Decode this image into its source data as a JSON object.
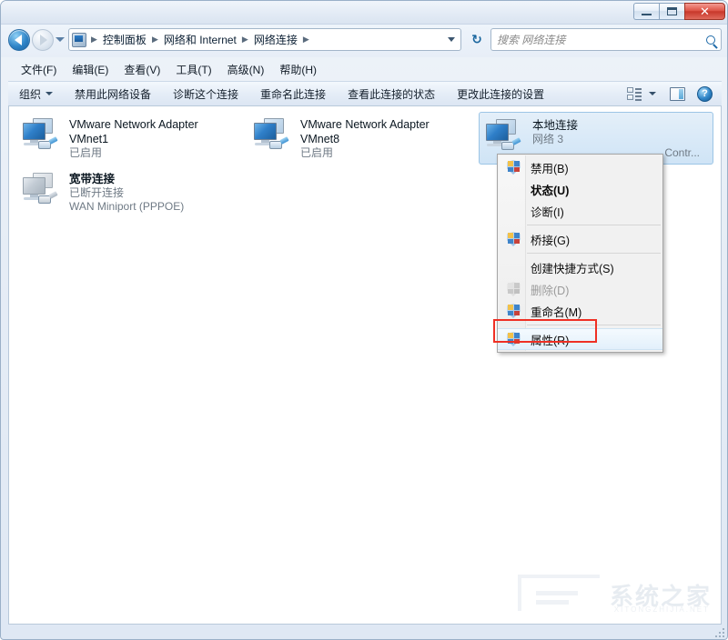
{
  "window": {
    "title": "",
    "buttons": {
      "minimize": "minimize",
      "maximize": "maximize",
      "close": "✕"
    }
  },
  "address": {
    "back_label": "back",
    "forward_label": "forward",
    "breadcrumbs": [
      "控制面板",
      "网络和 Internet",
      "网络连接"
    ],
    "separator": "▶",
    "refresh_label": "↻"
  },
  "search": {
    "placeholder": "搜索 网络连接"
  },
  "menubar": {
    "items": [
      "文件(F)",
      "编辑(E)",
      "查看(V)",
      "工具(T)",
      "高级(N)",
      "帮助(H)"
    ]
  },
  "toolbar": {
    "organize": "组织",
    "items": [
      "禁用此网络设备",
      "诊断这个连接",
      "重命名此连接",
      "查看此连接的状态",
      "更改此连接的设置"
    ],
    "help_glyph": "?"
  },
  "connections": [
    {
      "name": "VMware Network Adapter VMnet1",
      "status": "已启用",
      "device": "",
      "selected": false,
      "enabled": true,
      "bold": false
    },
    {
      "name": "VMware Network Adapter VMnet8",
      "status": "已启用",
      "device": "",
      "selected": false,
      "enabled": true,
      "bold": false
    },
    {
      "name": "本地连接",
      "status": "网络  3",
      "device": "Contr...",
      "selected": true,
      "enabled": true,
      "bold": false
    },
    {
      "name": "宽带连接",
      "status": "已断开连接",
      "device": "WAN Miniport (PPPOE)",
      "selected": false,
      "enabled": false,
      "bold": true
    }
  ],
  "context_menu": {
    "items": [
      {
        "label": "禁用(B)",
        "shield": true,
        "bold": false,
        "disabled": false,
        "highlight": false
      },
      {
        "label": "状态(U)",
        "shield": false,
        "bold": true,
        "disabled": false,
        "highlight": false
      },
      {
        "label": "诊断(I)",
        "shield": false,
        "bold": false,
        "disabled": false,
        "highlight": false
      },
      {
        "separator": true
      },
      {
        "label": "桥接(G)",
        "shield": true,
        "bold": false,
        "disabled": false,
        "highlight": false
      },
      {
        "separator": true
      },
      {
        "label": "创建快捷方式(S)",
        "shield": false,
        "bold": false,
        "disabled": false,
        "highlight": false
      },
      {
        "label": "删除(D)",
        "shield": true,
        "shield_dim": true,
        "bold": false,
        "disabled": true,
        "highlight": false
      },
      {
        "label": "重命名(M)",
        "shield": true,
        "bold": false,
        "disabled": false,
        "highlight": false
      },
      {
        "separator": true
      },
      {
        "label": "属性(R)",
        "shield": true,
        "bold": false,
        "disabled": false,
        "highlight": true
      }
    ],
    "highlight_color": "#ef3024"
  },
  "watermark": {
    "text": "系统之家",
    "sub": "XITONGZHIJIA.NET"
  }
}
